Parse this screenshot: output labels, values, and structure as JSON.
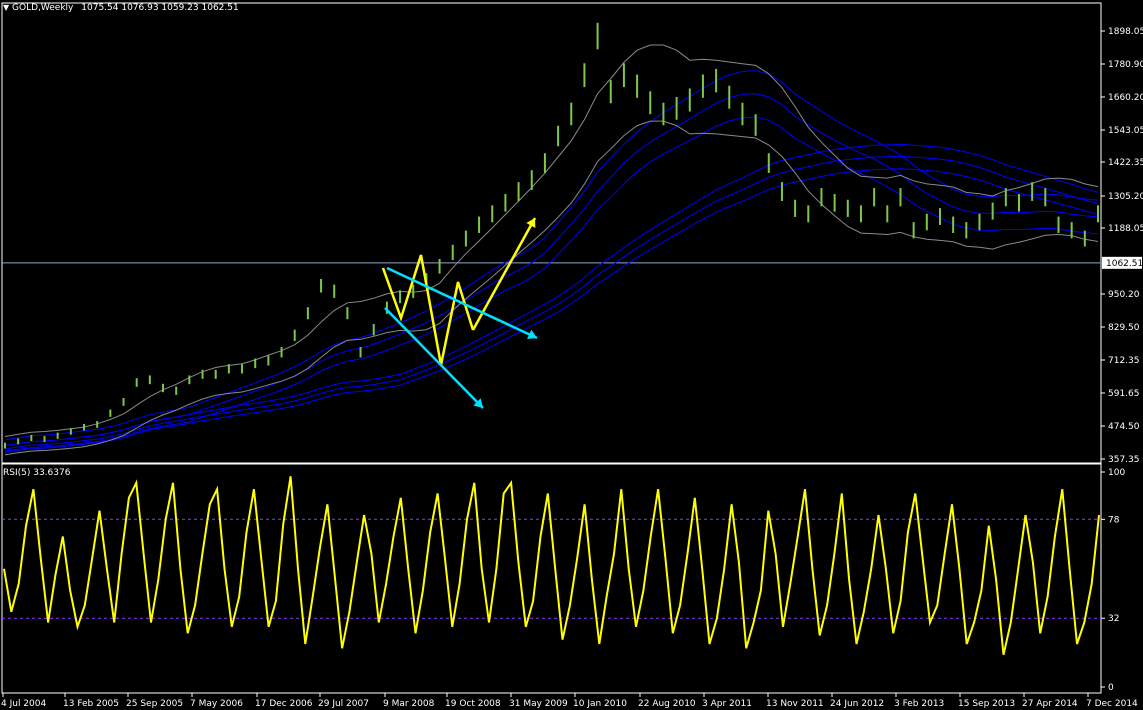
{
  "header": {
    "menu_glyph": "▼",
    "symbol_period": "GOLD,Weekly",
    "ohlc": "1075.54 1076.93 1059.23 1062.51"
  },
  "indicator": {
    "label": "RSI(5) 33.6376"
  },
  "colors": {
    "background": "#000000",
    "frame": "#ffffff",
    "price_bars": "#7cc84a",
    "envelopes": "#0000ff",
    "bands": "#8a8a8a",
    "arrows_yellow": "#ffff00",
    "arrows_cyan": "#00e0ff",
    "rsi_line": "#ffff00",
    "rsi_levels": "#8a3aff",
    "price_line": "#8fa8d0"
  },
  "chart_data": [
    {
      "type": "line",
      "title": "GOLD,Weekly",
      "y_axis_ticks": [
        "1898.05",
        "1780.90",
        "1660.20",
        "1543.05",
        "1422.35",
        "1305.20",
        "1188.05",
        "950.20",
        "829.50",
        "712.35",
        "591.65",
        "474.50",
        "357.35"
      ],
      "ylim": [
        357.35,
        1960
      ],
      "current_price_label": "1062.51",
      "x_tick_labels": [
        "4 Jul 2004",
        "13 Feb 2005",
        "25 Sep 2005",
        "7 May 2006",
        "17 Dec 2006",
        "29 Jul 2007",
        "9 Mar 2008",
        "19 Oct 2008",
        "31 May 2009",
        "10 Jan 2010",
        "22 Aug 2010",
        "3 Apr 2011",
        "13 Nov 2011",
        "24 Jun 2012",
        "3 Feb 2013",
        "15 Sep 2013",
        "27 Apr 2014",
        "7 Dec 2014"
      ],
      "series": [
        {
          "name": "",
          "values": [
            405,
            420,
            432,
            428,
            440,
            455,
            470,
            480,
            520,
            560,
            630,
            640,
            610,
            600,
            640,
            660,
            660,
            680,
            680,
            700,
            710,
            740,
            800,
            880,
            980,
            960,
            880,
            740,
            820,
            900,
            940,
            960,
            1000,
            1050,
            1100,
            1150,
            1200,
            1240,
            1280,
            1320,
            1360,
            1420,
            1520,
            1600,
            1740,
            1880,
            1680,
            1740,
            1700,
            1640,
            1600,
            1620,
            1650,
            1700,
            1720,
            1660,
            1600,
            1560,
            1420,
            1320,
            1260,
            1240,
            1300,
            1280,
            1260,
            1240,
            1300,
            1240,
            1300,
            1180,
            1210,
            1230,
            1200,
            1180,
            1210,
            1250,
            1300,
            1280,
            1320,
            1300,
            1200,
            1180,
            1150,
            1240
          ]
        }
      ]
    },
    {
      "type": "line",
      "title": "RSI(5) 33.6376",
      "y_axis_ticks": [
        "100",
        "78",
        "32",
        "0"
      ],
      "ylim": [
        0,
        100
      ],
      "levels": [
        78,
        32
      ],
      "series": [
        {
          "name": "",
          "values": [
            55,
            35,
            48,
            75,
            92,
            60,
            30,
            52,
            70,
            45,
            28,
            38,
            60,
            82,
            55,
            30,
            62,
            88,
            95,
            62,
            30,
            50,
            78,
            95,
            55,
            25,
            38,
            62,
            85,
            92,
            55,
            28,
            42,
            72,
            92,
            60,
            28,
            40,
            76,
            98,
            55,
            20,
            42,
            65,
            85,
            52,
            18,
            35,
            58,
            80,
            62,
            30,
            48,
            70,
            88,
            55,
            25,
            45,
            72,
            90,
            60,
            28,
            48,
            78,
            95,
            55,
            30,
            55,
            90,
            95,
            58,
            28,
            40,
            70,
            90,
            55,
            22,
            38,
            60,
            85,
            50,
            20,
            42,
            62,
            92,
            55,
            28,
            45,
            70,
            92,
            60,
            25,
            38,
            62,
            88,
            55,
            20,
            32,
            55,
            85,
            58,
            18,
            30,
            45,
            82,
            62,
            28,
            48,
            70,
            92,
            55,
            24,
            38,
            62,
            90,
            50,
            20,
            35,
            55,
            80,
            55,
            25,
            40,
            72,
            90,
            60,
            30,
            38,
            62,
            85,
            55,
            20,
            30,
            45,
            75,
            50,
            15,
            30,
            55,
            80,
            58,
            25,
            42,
            70,
            92,
            55,
            20,
            30,
            48,
            80
          ]
        }
      ]
    }
  ]
}
